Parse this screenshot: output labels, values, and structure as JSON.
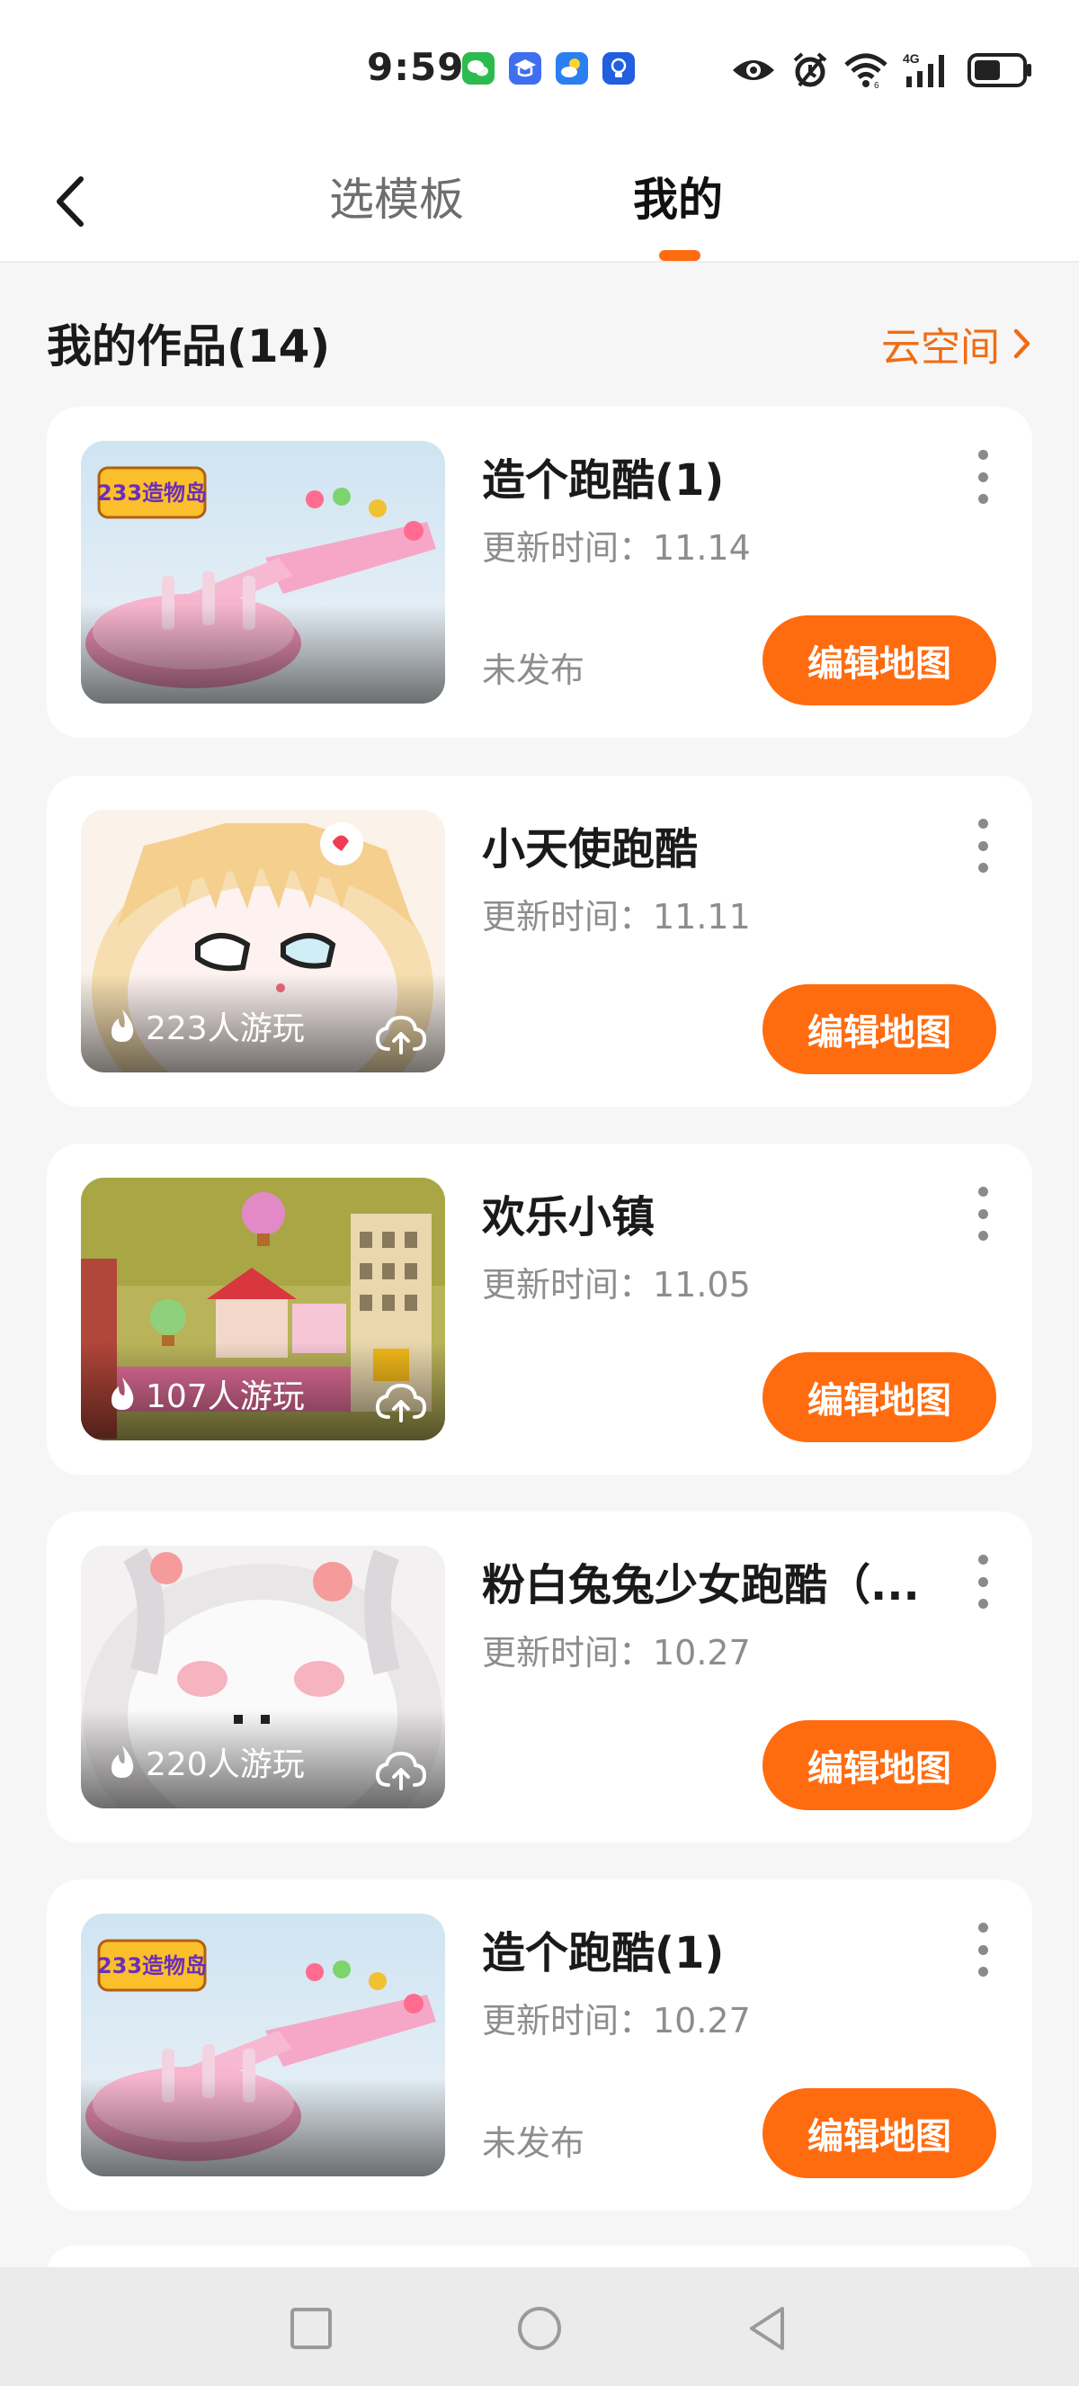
{
  "status_bar": {
    "time": "9:59",
    "notification_icons": [
      "wechat-icon",
      "study-app-icon",
      "weather-app-icon",
      "bulb-app-icon"
    ],
    "system_icons": [
      "eye-icon",
      "alarm-icon",
      "wifi-icon",
      "cellular-4g-icon",
      "battery-icon"
    ],
    "network_label": "4G"
  },
  "header": {
    "tabs": [
      {
        "label": "选模板",
        "active": false
      },
      {
        "label": "我的",
        "active": true
      }
    ]
  },
  "section": {
    "title": "我的作品(14)",
    "cloud_link": "云空间"
  },
  "works": [
    {
      "title": "造个跑酷(1)",
      "updated": "更新时间：11.14",
      "status": "未发布",
      "plays": "",
      "thumb": "parkour",
      "button": "编辑地图"
    },
    {
      "title": "小天使跑酷",
      "updated": "更新时间：11.11",
      "status": "",
      "plays": "223人游玩",
      "thumb": "angel",
      "button": "编辑地图"
    },
    {
      "title": "欢乐小镇",
      "updated": "更新时间：11.05",
      "status": "",
      "plays": "107人游玩",
      "thumb": "town",
      "button": "编辑地图"
    },
    {
      "title": "粉白兔兔少女跑酷（...",
      "updated": "更新时间：10.27",
      "status": "",
      "plays": "220人游玩",
      "thumb": "bunny",
      "button": "编辑地图"
    },
    {
      "title": "造个跑酷(1)",
      "updated": "更新时间：10.27",
      "status": "未发布",
      "plays": "",
      "thumb": "parkour",
      "button": "编辑地图"
    }
  ],
  "thumb_badge_text": "233造物岛",
  "colors": {
    "accent": "#ff6b0f",
    "link": "#f26b12",
    "muted": "#8d8d8d"
  }
}
